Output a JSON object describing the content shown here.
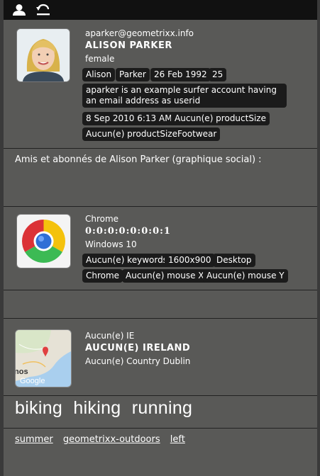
{
  "profile": {
    "email": "aparker@geometrixx.info",
    "name": "ALISON PARKER",
    "gender": "female",
    "chips_row1": [
      "Alison",
      "Parker",
      "26 Feb 1992",
      "25"
    ],
    "description": "aparker is an example surfer account having an email address as userid",
    "chips_row3": [
      "8 Sep 2010 6:13 AM",
      "Aucun(e) productSize"
    ],
    "chips_row4": [
      "Aucun(e) productSizeFootwear"
    ]
  },
  "social": {
    "label": "Amis et abonnés de Alison Parker (graphique social) :"
  },
  "device": {
    "browser": "Chrome",
    "ip": "0:0:0:0:0:0:0:1",
    "os": "Windows 10",
    "chips_row1": [
      "Aucun(e) keywords",
      "1600x900",
      "Desktop"
    ],
    "chips_row2": [
      "Chrome",
      "Aucun(e) mouse X",
      "Aucun(e) mouse Y"
    ]
  },
  "location": {
    "line1": "Aucun(e) IE",
    "line2": "AUCUN(E) IRELAND",
    "line3": "Aucun(e) Country Dublin",
    "map_text": "nos",
    "map_brand": "Google"
  },
  "tags": [
    "biking",
    "hiking",
    "running"
  ],
  "links": [
    "summer",
    "geometrixx-outdoors",
    "left"
  ],
  "icons": {
    "user": "user-icon",
    "back": "undo-icon"
  }
}
